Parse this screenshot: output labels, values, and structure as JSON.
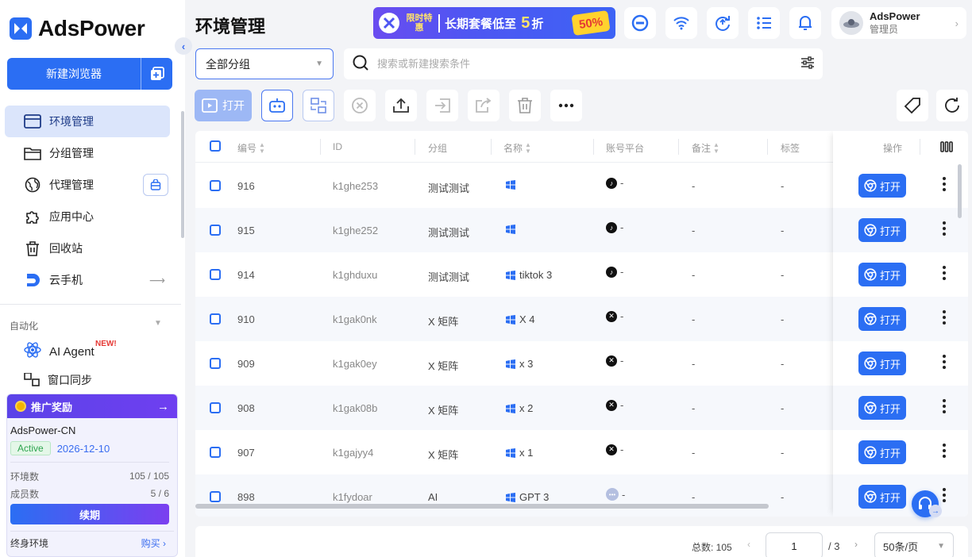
{
  "brand": {
    "name": "AdsPower"
  },
  "sidebar": {
    "new_browser": "新建浏览器",
    "items": [
      {
        "label": "环境管理",
        "icon": "browser-window-icon",
        "active": true
      },
      {
        "label": "分组管理",
        "icon": "folder-icon"
      },
      {
        "label": "代理管理",
        "icon": "globe-icon"
      },
      {
        "label": "应用中心",
        "icon": "puzzle-icon"
      },
      {
        "label": "回收站",
        "icon": "trash-icon"
      },
      {
        "label": "云手机",
        "icon": "cloud-phone-icon"
      }
    ],
    "automation_label": "自动化",
    "ai_agent": "AI Agent",
    "new_badge": "NEW!",
    "partial_item": "窗口同步"
  },
  "promo": {
    "header": "推广奖励",
    "account": "AdsPower-CN",
    "status": "Active",
    "expiry": "2026-12-10",
    "env_label": "环境数",
    "env_value": "105 / 105",
    "member_label": "成员数",
    "member_value": "5 / 6",
    "renew": "续期",
    "lifetime": "终身环境",
    "buy": "购买"
  },
  "header": {
    "title": "环境管理",
    "banner_tag": "限时特惠",
    "banner_text": "长期套餐低至",
    "banner_num": "5",
    "banner_unit": "折",
    "banner_pct": "50%",
    "user_name": "AdsPower",
    "user_role": "管理员"
  },
  "filters": {
    "group": "全部分组",
    "search_placeholder": "搜索或新建搜索条件"
  },
  "actions": {
    "open": "打开"
  },
  "table": {
    "columns": {
      "num": "编号",
      "id": "ID",
      "group": "分组",
      "name": "名称",
      "platform": "账号平台",
      "remark": "备注",
      "tag": "标签",
      "ops": "操作"
    },
    "open_label": "打开",
    "rows": [
      {
        "num": "916",
        "id": "k1ghe253",
        "group": "测试测试",
        "name": "",
        "platform": "tiktok",
        "remark": "-",
        "tag": "-"
      },
      {
        "num": "915",
        "id": "k1ghe252",
        "group": "测试测试",
        "name": "",
        "platform": "tiktok",
        "remark": "-",
        "tag": "-"
      },
      {
        "num": "914",
        "id": "k1ghduxu",
        "group": "测试测试",
        "name": "tiktok 3",
        "platform": "tiktok",
        "remark": "-",
        "tag": "-"
      },
      {
        "num": "910",
        "id": "k1gak0nk",
        "group": "X 矩阵",
        "name": "X 4",
        "platform": "x",
        "remark": "-",
        "tag": "-"
      },
      {
        "num": "909",
        "id": "k1gak0ey",
        "group": "X 矩阵",
        "name": "x 3",
        "platform": "x",
        "remark": "-",
        "tag": "-"
      },
      {
        "num": "908",
        "id": "k1gak08b",
        "group": "X 矩阵",
        "name": "x 2",
        "platform": "x",
        "remark": "-",
        "tag": "-"
      },
      {
        "num": "907",
        "id": "k1gajyy4",
        "group": "X 矩阵",
        "name": "x 1",
        "platform": "x",
        "remark": "-",
        "tag": "-"
      },
      {
        "num": "898",
        "id": "k1fydoar",
        "group": "AI",
        "name": "GPT 3",
        "platform": "other",
        "remark": "-",
        "tag": "-"
      }
    ],
    "platform_dash": "-"
  },
  "pagination": {
    "total": "总数: 105",
    "page": "1",
    "pages": "/ 3",
    "size": "50条/页"
  }
}
